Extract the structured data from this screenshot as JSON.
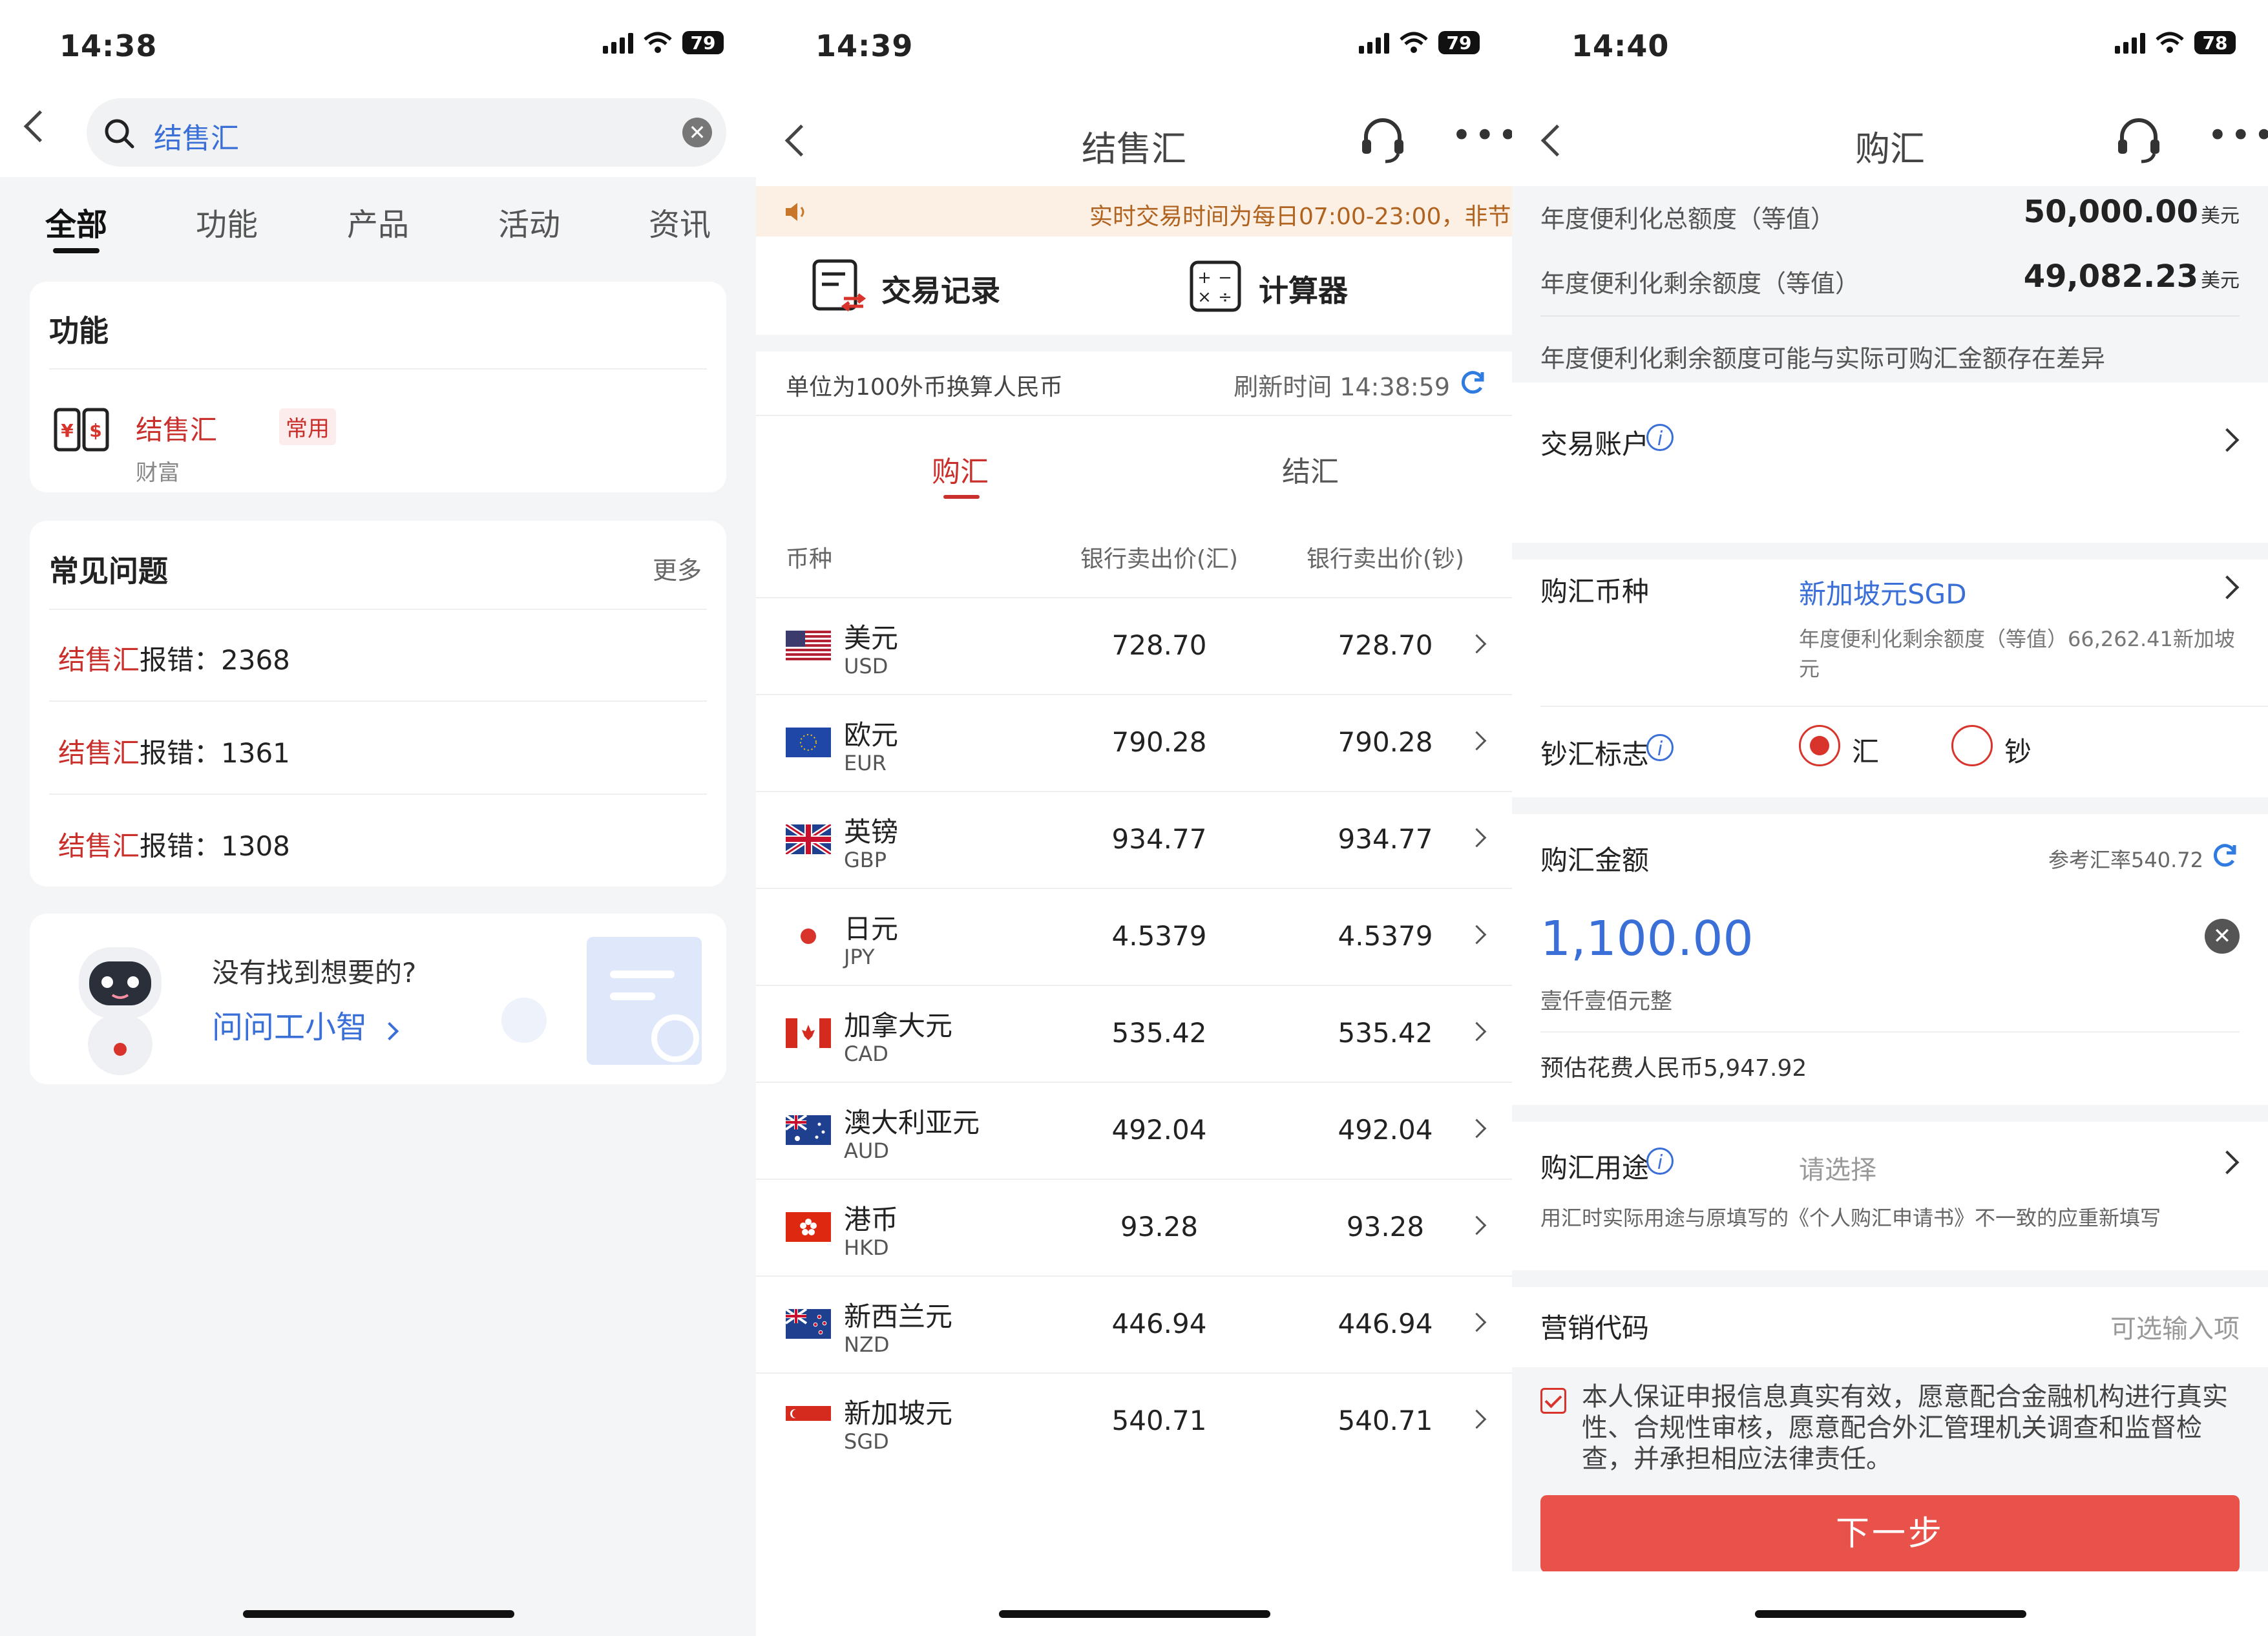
{
  "screen1": {
    "status": {
      "time": "14:38",
      "battery": "79"
    },
    "search": {
      "value": "结售汇"
    },
    "tabs": [
      "全部",
      "功能",
      "产品",
      "活动",
      "资讯"
    ],
    "function_card": {
      "title": "功能",
      "item_name": "结售汇",
      "item_tag": "常用",
      "item_category": "财富"
    },
    "faq": {
      "title": "常见问题",
      "more": "更多",
      "items": [
        {
          "keyword": "结售汇",
          "text": "报错：2368"
        },
        {
          "keyword": "结售汇",
          "text": "报错：1361"
        },
        {
          "keyword": "结售汇",
          "text": "报错：1308"
        }
      ]
    },
    "assistant": {
      "prompt": "没有找到想要的?",
      "link": "问问工小智"
    }
  },
  "screen2": {
    "status": {
      "time": "14:39",
      "battery": "79"
    },
    "title": "结售汇",
    "notice": "实时交易时间为每日07:00-23:00，非节",
    "shortcuts": {
      "records": "交易记录",
      "calculator": "计算器"
    },
    "unit_note": "单位为100外币换算人民币",
    "refresh": "刷新时间 14:38:59",
    "tabs": [
      "购汇",
      "结汇"
    ],
    "table_headers": [
      "币种",
      "银行卖出价(汇)",
      "银行卖出价(钞)"
    ],
    "rates": [
      {
        "name": "美元",
        "code": "USD",
        "fx": "728.70",
        "cash": "728.70"
      },
      {
        "name": "欧元",
        "code": "EUR",
        "fx": "790.28",
        "cash": "790.28"
      },
      {
        "name": "英镑",
        "code": "GBP",
        "fx": "934.77",
        "cash": "934.77"
      },
      {
        "name": "日元",
        "code": "JPY",
        "fx": "4.5379",
        "cash": "4.5379"
      },
      {
        "name": "加拿大元",
        "code": "CAD",
        "fx": "535.42",
        "cash": "535.42"
      },
      {
        "name": "澳大利亚元",
        "code": "AUD",
        "fx": "492.04",
        "cash": "492.04"
      },
      {
        "name": "港币",
        "code": "HKD",
        "fx": "93.28",
        "cash": "93.28"
      },
      {
        "name": "新西兰元",
        "code": "NZD",
        "fx": "446.94",
        "cash": "446.94"
      },
      {
        "name": "新加坡元",
        "code": "SGD",
        "fx": "540.71",
        "cash": "540.71"
      }
    ]
  },
  "screen3": {
    "status": {
      "time": "14:40",
      "battery": "78"
    },
    "title": "购汇",
    "quota_total_label": "年度便利化总额度（等值）",
    "quota_total_value": "50,000.00",
    "quota_total_unit": "美元",
    "quota_remain_label": "年度便利化剩余额度（等值）",
    "quota_remain_value": "49,082.23",
    "quota_remain_unit": "美元",
    "quota_note": "年度便利化剩余额度可能与实际可购汇金额存在差异",
    "account_label": "交易账户",
    "currency_label": "购汇币种",
    "currency_value": "新加坡元SGD",
    "currency_quota": "年度便利化剩余额度（等值）66,262.41新加坡元",
    "cash_flag_label": "钞汇标志",
    "option_fx": "汇",
    "option_cash": "钞",
    "amount_label": "购汇金额",
    "ref_rate": "参考汇率540.72",
    "amount_value": "1,100.00",
    "amount_words": "壹仟壹佰元整",
    "estimate": "预估花费人民币5,947.92",
    "purpose_label": "购汇用途",
    "purpose_placeholder": "请选择",
    "purpose_note": "用汇时实际用途与原填写的《个人购汇申请书》不一致的应重新填写",
    "marketing_label": "营销代码",
    "marketing_placeholder": "可选输入项",
    "declaration": "本人保证申报信息真实有效，愿意配合金融机构进行真实性、合规性审核，愿意配合外汇管理机关调查和监督检查，并承担相应法律责任。",
    "next_button": "下一步"
  }
}
